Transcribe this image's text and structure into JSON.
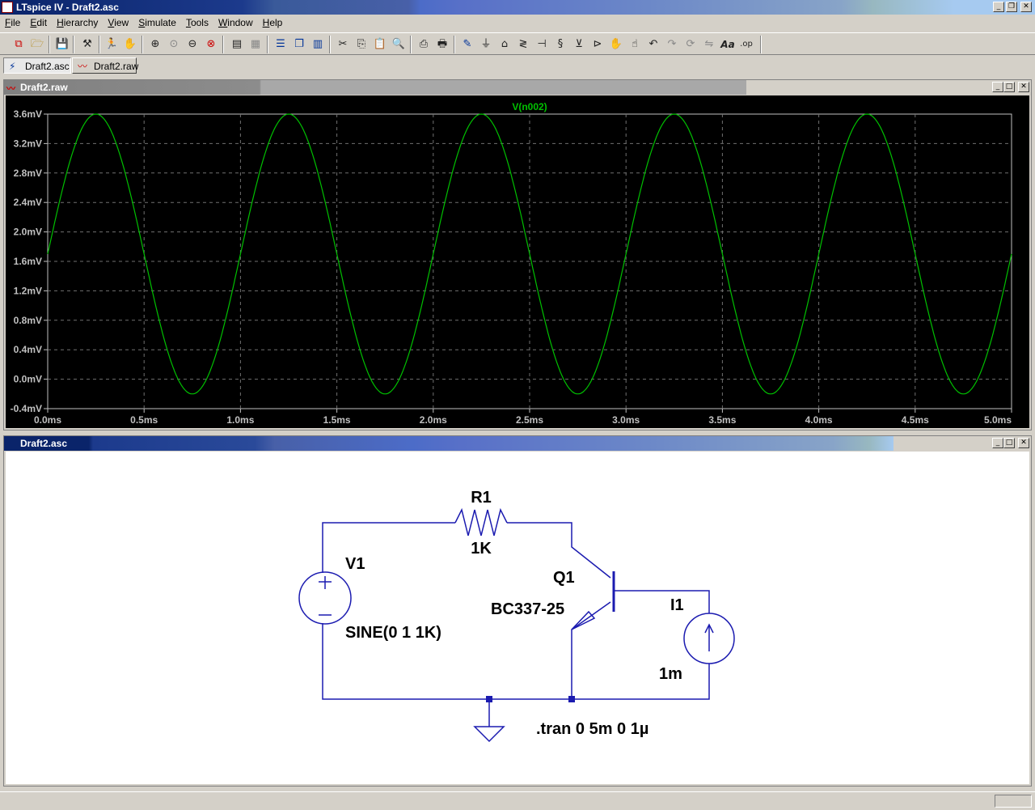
{
  "app": {
    "title": "LTspice IV - Draft2.asc",
    "caption_buttons": [
      "_",
      "❐",
      "✕"
    ]
  },
  "menu": [
    {
      "label": "File",
      "accel": "F"
    },
    {
      "label": "Edit",
      "accel": "E"
    },
    {
      "label": "Hierarchy",
      "accel": "H"
    },
    {
      "label": "View",
      "accel": "V"
    },
    {
      "label": "Simulate",
      "accel": "S"
    },
    {
      "label": "Tools",
      "accel": "T"
    },
    {
      "label": "Window",
      "accel": "W"
    },
    {
      "label": "Help",
      "accel": "H"
    }
  ],
  "toolbar": {
    "icons": [
      "new-schematic-icon",
      "open-icon",
      "save-icon",
      "control-panel-icon",
      "run-icon",
      "pan-icon",
      "zoom-in-icon",
      "zoom-full-icon",
      "zoom-out-icon",
      "zoom-cancel-icon",
      "autorange-icon",
      "grid-icon",
      "tile-horizontal-icon",
      "cascade-icon",
      "tile-vertical-icon",
      "cut-icon",
      "copy-icon",
      "paste-icon",
      "find-icon",
      "print-setup-icon",
      "print-icon",
      "draw-wire-icon",
      "ground-icon",
      "label-net-icon",
      "resistor-icon",
      "capacitor-icon",
      "inductor-icon",
      "diode-icon",
      "component-icon",
      "move-icon",
      "drag-icon",
      "undo-icon",
      "redo-icon",
      "rotate-icon",
      "mirror-icon",
      "text-icon",
      "spice-directive-icon"
    ],
    "text_icon_label": "Aa",
    "directive_icon_label": ".op"
  },
  "tabs": [
    {
      "label": "Draft2.asc",
      "icon": "schematic-icon",
      "active": true
    },
    {
      "label": "Draft2.raw",
      "icon": "waveform-icon",
      "active": false
    }
  ],
  "plot_window": {
    "title": "Draft2.raw",
    "trace_label": "V(n002)",
    "trace_color": "#00c000",
    "background": "#000000"
  },
  "chart_data": {
    "type": "line",
    "title": "",
    "series": [
      {
        "name": "V(n002)",
        "color": "#00c000",
        "function": "1.7 + 1.9*sin(2*pi*1000*t)",
        "x": [
          0.0,
          0.25,
          0.5,
          0.75,
          1.0,
          1.25,
          1.5,
          1.75,
          2.0,
          2.25,
          2.5,
          2.75,
          3.0,
          3.25,
          3.5,
          3.75,
          4.0,
          4.25,
          4.5,
          4.75,
          5.0
        ],
        "y": [
          1.7,
          3.6,
          1.7,
          -0.2,
          1.7,
          3.6,
          1.7,
          -0.2,
          1.7,
          3.6,
          1.7,
          -0.2,
          1.7,
          3.6,
          1.7,
          -0.2,
          1.7,
          3.6,
          1.7,
          -0.2,
          1.7
        ]
      }
    ],
    "x_unit": "ms",
    "y_unit": "mV",
    "xlim": [
      0.0,
      5.0
    ],
    "ylim": [
      -0.4,
      3.6
    ],
    "xticks": [
      "0.0ms",
      "0.5ms",
      "1.0ms",
      "1.5ms",
      "2.0ms",
      "2.5ms",
      "3.0ms",
      "3.5ms",
      "4.0ms",
      "4.5ms",
      "5.0ms"
    ],
    "yticks": [
      "3.6mV",
      "3.2mV",
      "2.8mV",
      "2.4mV",
      "2.0mV",
      "1.6mV",
      "1.2mV",
      "0.8mV",
      "0.4mV",
      "0.0mV",
      "-0.4mV"
    ],
    "grid": true,
    "legend": "top-center"
  },
  "schematic_window": {
    "title": "Draft2.asc",
    "wire_color": "#1b1bb0",
    "labels": {
      "r1_name": "R1",
      "r1_value": "1K",
      "v1_name": "V1",
      "v1_value": "SINE(0 1 1K)",
      "q1_name": "Q1",
      "q1_value": "BC337-25",
      "i1_name": "I1",
      "i1_value": "1m",
      "directive": ".tran 0 5m 0 1µ"
    }
  }
}
